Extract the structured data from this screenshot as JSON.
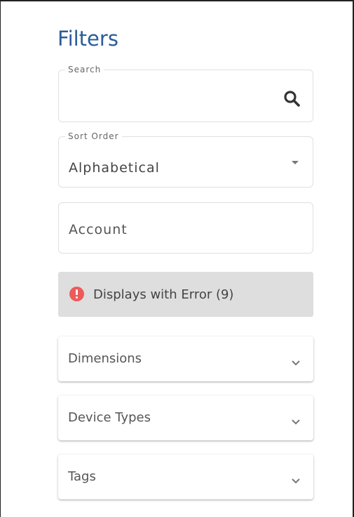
{
  "header": {
    "title": "Filters"
  },
  "search": {
    "label": "Search",
    "value": "",
    "icon": "search-icon"
  },
  "sort": {
    "label": "Sort Order",
    "value": "Alphabetical",
    "icon": "caret-down-icon"
  },
  "account": {
    "placeholder": "Account",
    "value": ""
  },
  "error_filter": {
    "label": "Displays with Error (9)",
    "icon": "error-icon",
    "icon_color": "#ee5a5a",
    "background": "#dedede"
  },
  "panels": [
    {
      "label": "Dimensions",
      "icon": "chevron-down-icon"
    },
    {
      "label": "Device Types",
      "icon": "chevron-down-icon"
    },
    {
      "label": "Tags",
      "icon": "chevron-down-icon"
    }
  ],
  "colors": {
    "title": "#2b5c9a",
    "text": "#444444"
  }
}
